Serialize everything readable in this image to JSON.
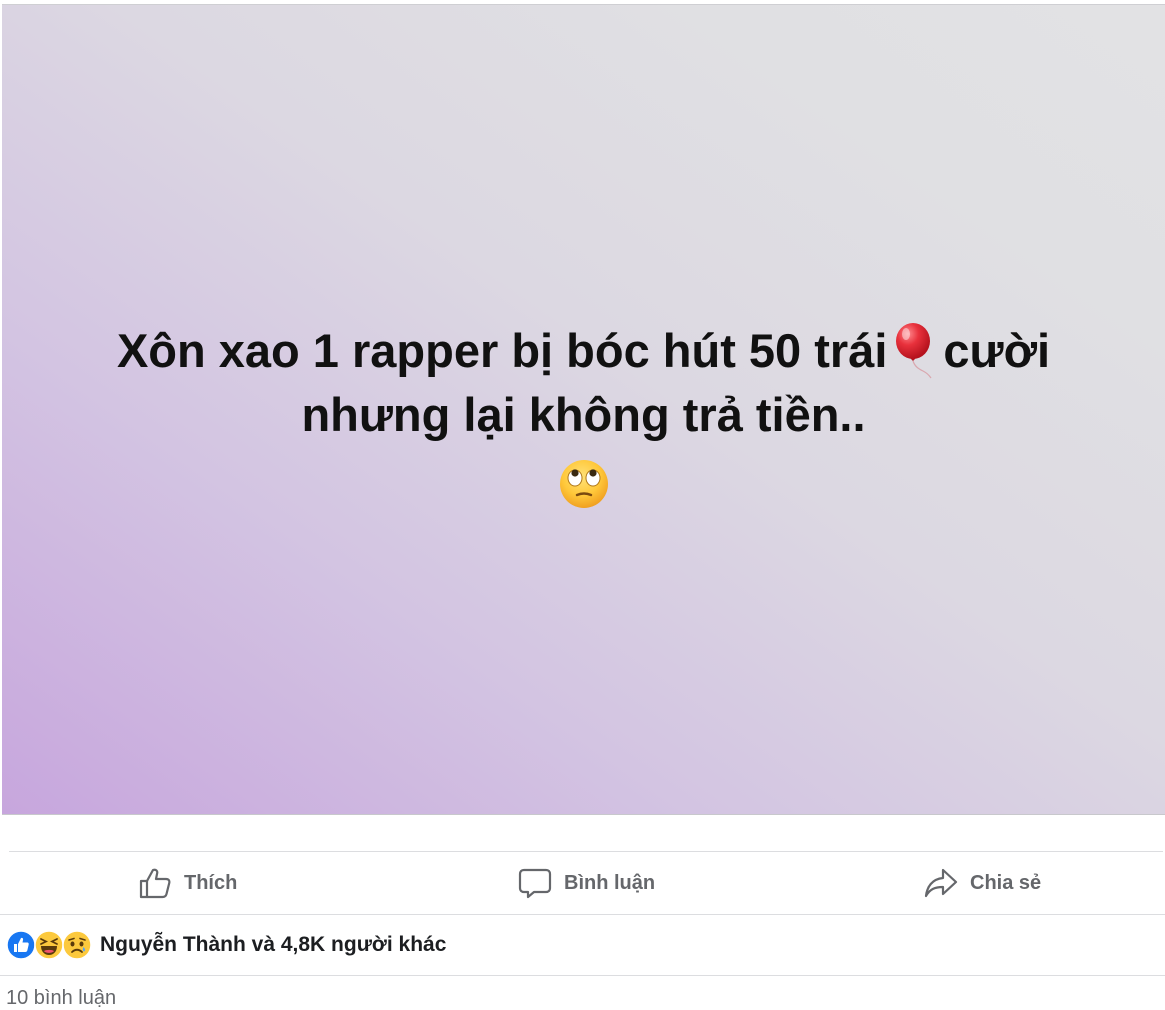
{
  "post": {
    "text_line1": "Xôn xao 1 rapper bị bóc hút 50 trái",
    "text_line1_end": "cười",
    "text_line2": "nhưng lại không trả tiền..",
    "inline_emoji": "balloon",
    "trailing_emoji": "face-with-rolling-eyes",
    "background_gradient": [
      "#c7a6dd",
      "#e2e2e4"
    ]
  },
  "actions": {
    "like_label": "Thích",
    "comment_label": "Bình luận",
    "share_label": "Chia sẻ"
  },
  "reactions": {
    "types": [
      "like",
      "haha",
      "sad"
    ],
    "summary": "Nguyễn Thành và 4,8K người khác"
  },
  "comments": {
    "peek_text": "10 bình luận"
  },
  "colors": {
    "like_blue": "#1877f2",
    "action_gray": "#65676b",
    "text_dark": "#1c1e21",
    "divider": "#dcdde0"
  }
}
